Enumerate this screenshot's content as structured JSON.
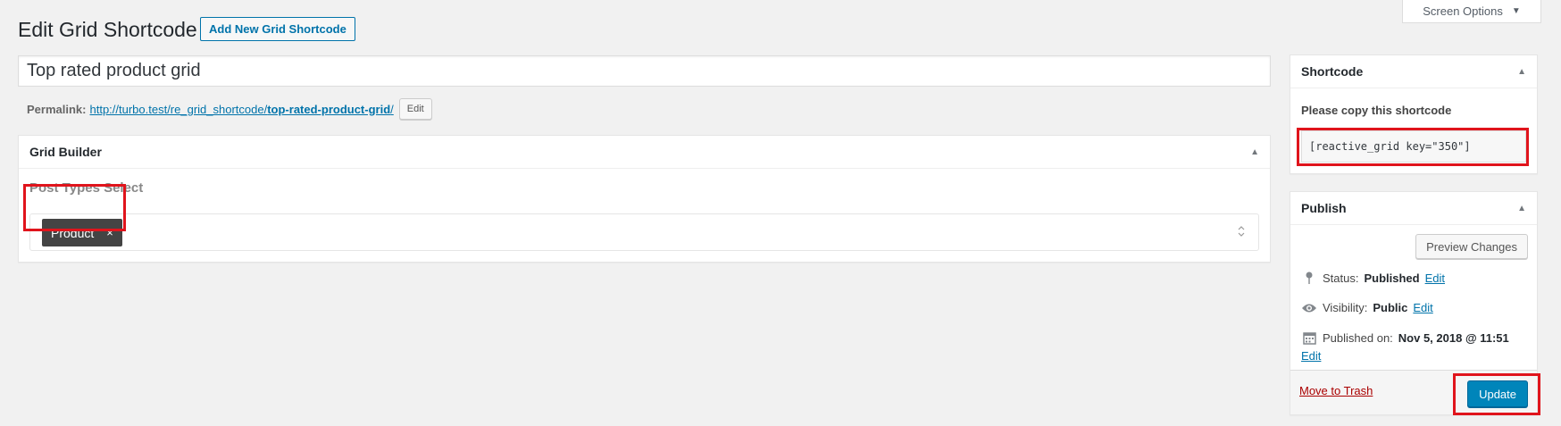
{
  "header": {
    "screen_options": "Screen Options",
    "title": "Edit Grid Shortcode",
    "add_new": "Add New Grid Shortcode"
  },
  "post": {
    "title": "Top rated product grid",
    "permalink_label": "Permalink:",
    "permalink_base": "http://turbo.test/re_grid_shortcode/",
    "permalink_slug": "top-rated-product-grid",
    "permalink_trail": "/",
    "permalink_edit": "Edit"
  },
  "grid_builder": {
    "heading": "Grid Builder",
    "field_label": "Post Types Select",
    "selected": [
      "Product"
    ],
    "remove_glyph": "×"
  },
  "shortcode": {
    "heading": "Shortcode",
    "instructions": "Please copy this shortcode",
    "value": "[reactive_grid key=\"350\"]"
  },
  "publish": {
    "heading": "Publish",
    "preview": "Preview Changes",
    "status_label": "Status:",
    "status_value": "Published",
    "visibility_label": "Visibility:",
    "visibility_value": "Public",
    "published_label": "Published on:",
    "published_value": "Nov 5, 2018 @ 11:51",
    "edit": "Edit",
    "trash": "Move to Trash",
    "update": "Update"
  },
  "icons": {
    "dropdown": "▼",
    "collapse": "▲",
    "pin": "pin-icon",
    "eye": "eye-icon",
    "calendar": "calendar-icon"
  },
  "colors": {
    "accent": "#0073aa",
    "primary_button": "#0085ba",
    "highlight_outline": "#e0141c",
    "trash": "#a00000"
  }
}
